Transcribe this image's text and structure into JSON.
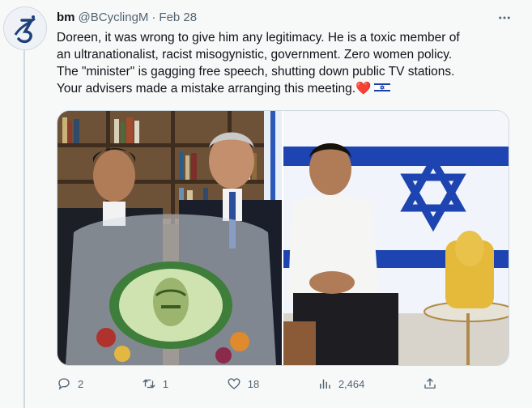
{
  "tweet": {
    "author_name": "bm",
    "handle": "@BCyclingM",
    "separator": "·",
    "date": "Feb 28",
    "lines": [
      "Doreen, it was wrong to give him any legitimacy. He is  a toxic member of",
      "an ultranationalist, racist misogynistic, government. Zero women policy.",
      "The \"minister\" is  gagging free speech, shutting down public TV stations.",
      "Your advisers made a mistake arranging this meeting."
    ],
    "heart_emoji": "❤️",
    "flag_emoji": "israel-flag-emoji",
    "counts": {
      "replies": "2",
      "retweets": "1",
      "likes": "18",
      "views": "2,464"
    }
  },
  "icons": {
    "more": "more-horizontal-icon",
    "reply": "reply-icon",
    "retweet": "retweet-icon",
    "like": "like-icon",
    "views": "views-icon",
    "share": "share-icon"
  },
  "colors": {
    "text": "#0f1419",
    "secondary": "#536471",
    "background": "#f7f9f9",
    "border": "#cfd9de",
    "flag_blue": "#1a3fa6",
    "heart": "#e0245e"
  }
}
